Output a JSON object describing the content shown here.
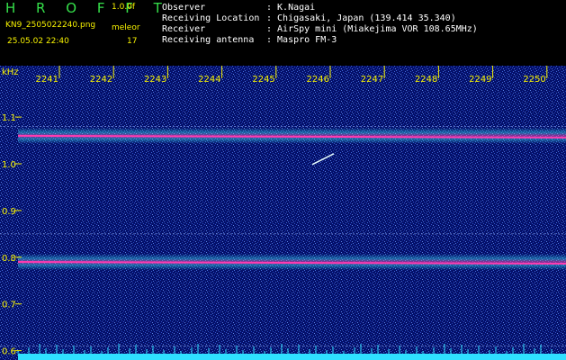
{
  "header": {
    "app_title": "H R O F F T",
    "version": "1.0.0f",
    "filename": "KN9_2505022240.png",
    "mode_label": "meleor",
    "datetime": "25.05.02 22:40",
    "count": "17",
    "info": [
      {
        "key": "Observer",
        "value": ": K.Nagai"
      },
      {
        "key": "Receiving Location",
        "value": ": Chigasaki, Japan (139.414 35.340)"
      },
      {
        "key": "Receiver",
        "value": ": AirSpy mini (Miakejima VOR 108.65MHz)"
      },
      {
        "key": "Receiving antenna",
        "value": ": Maspro FM-3"
      }
    ]
  },
  "chart_data": {
    "type": "heatmap",
    "title": "",
    "ylabel": "kHz",
    "x_tick_labels": [
      "2241",
      "2242",
      "2243",
      "2244",
      "2245",
      "2246",
      "2247",
      "2248",
      "2249",
      "2250"
    ],
    "y_tick_labels": [
      "1.1",
      "1.0",
      "0.9",
      "0.8",
      "0.7",
      "0.6"
    ],
    "y_ticks": [
      1.1,
      1.0,
      0.9,
      0.8,
      0.7,
      0.6
    ],
    "ylim": [
      0.58,
      1.21
    ],
    "bands": [
      {
        "freq_khz": 1.06,
        "strength": "strong"
      },
      {
        "freq_khz": 0.79,
        "strength": "strong"
      }
    ],
    "faint_lines_khz": [
      1.08,
      0.85,
      0.61
    ],
    "meteor_echo": {
      "time": "2245.9",
      "freq_khz": 1.01
    },
    "colors": {
      "background": "#04106a",
      "noise": "#3d67d6",
      "band_core": "#ff3bb0",
      "band_glow": "#3ff0ff",
      "baseline": "#2fe0ff"
    }
  }
}
